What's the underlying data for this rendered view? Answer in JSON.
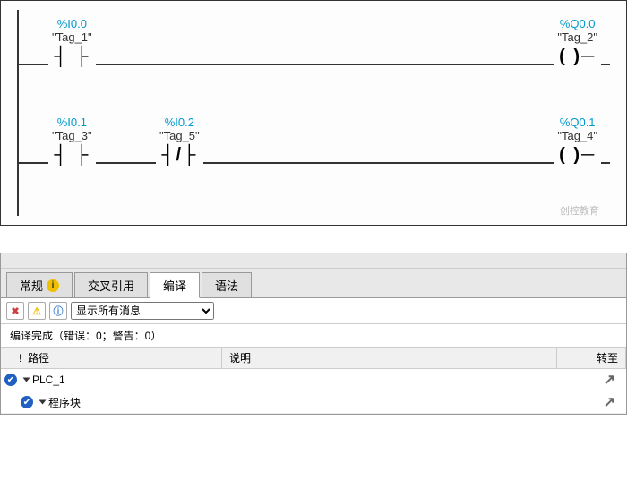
{
  "ladder": {
    "rung1": {
      "c1": {
        "addr": "%I0.0",
        "name": "\"Tag_1\""
      },
      "out": {
        "addr": "%Q0.0",
        "name": "\"Tag_2\""
      }
    },
    "rung2": {
      "c1": {
        "addr": "%I0.1",
        "name": "\"Tag_3\""
      },
      "c2": {
        "addr": "%I0.2",
        "name": "\"Tag_5\""
      },
      "out": {
        "addr": "%Q0.1",
        "name": "\"Tag_4\""
      }
    },
    "watermark": "创控教育"
  },
  "tabs": {
    "general": "常规",
    "crossref": "交叉引用",
    "compile": "编译",
    "syntax": "语法"
  },
  "toolbar": {
    "filter_label": "显示所有消息"
  },
  "status": "编译完成（错误：0；警告：0）",
  "table": {
    "headers": {
      "path": "路径",
      "desc": "说明",
      "goto": "转至"
    },
    "rows": [
      {
        "indent": 1,
        "label": "PLC_1"
      },
      {
        "indent": 2,
        "label": "程序块"
      }
    ]
  }
}
